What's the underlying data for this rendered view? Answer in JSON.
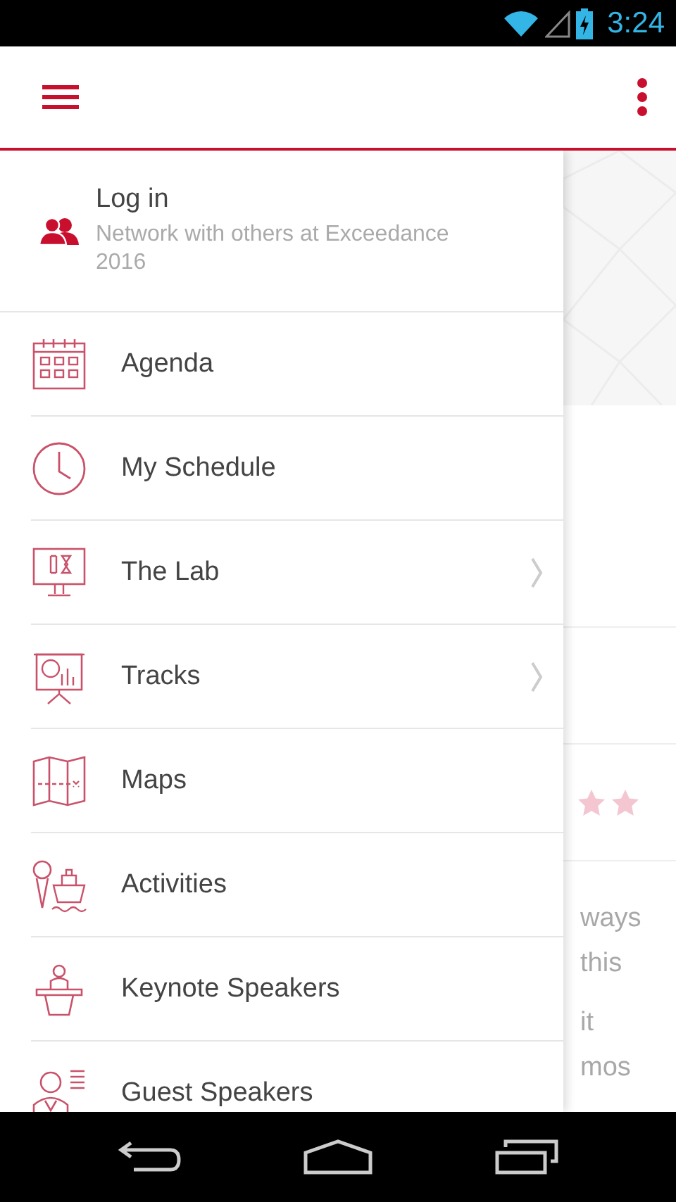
{
  "status_bar": {
    "time": "3:24"
  },
  "drawer": {
    "account": {
      "title": "Log in",
      "subtitle": "Network with others at Exceedance 2016"
    },
    "items": [
      {
        "label": "Agenda",
        "has_submenu": false
      },
      {
        "label": "My Schedule",
        "has_submenu": false
      },
      {
        "label": "The Lab",
        "has_submenu": true
      },
      {
        "label": "Tracks",
        "has_submenu": true
      },
      {
        "label": "Maps",
        "has_submenu": false
      },
      {
        "label": "Activities",
        "has_submenu": false
      },
      {
        "label": "Keynote Speakers",
        "has_submenu": false
      },
      {
        "label": "Guest Speakers",
        "has_submenu": false
      }
    ]
  },
  "background": {
    "texts": [
      "ways",
      "this",
      "it",
      "mos"
    ]
  }
}
